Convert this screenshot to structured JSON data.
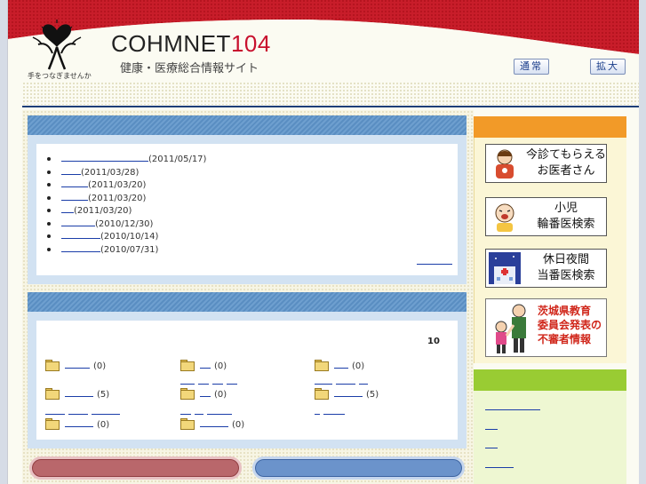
{
  "header": {
    "logo_caption": "手をつなぎませんか",
    "title_main": "COHMNET",
    "title_num": "104",
    "subtitle": "健康・医療総合情報サイト",
    "btn_normal": "通常",
    "btn_large": "拡大"
  },
  "news": {
    "items": [
      {
        "link_w": 98,
        "date": "(2011/05/17)"
      },
      {
        "link_w": 22,
        "date": "(2011/03/28)"
      },
      {
        "link_w": 30,
        "date": "(2011/03/20)"
      },
      {
        "link_w": 30,
        "date": "(2011/03/20)"
      },
      {
        "link_w": 14,
        "date": "(2011/03/20)"
      },
      {
        "link_w": 38,
        "date": "(2010/12/30)"
      },
      {
        "link_w": 44,
        "date": "(2010/10/14)"
      },
      {
        "link_w": 44,
        "date": "(2010/07/31)"
      }
    ]
  },
  "categories": {
    "count_label": "10",
    "items": [
      {
        "count": "(0)"
      },
      {
        "count": "(0)"
      },
      {
        "count": "(0)"
      },
      {
        "count": "(5)"
      },
      {
        "count": "(0)"
      },
      {
        "count": "(5)"
      },
      {
        "count": "(0)"
      },
      {
        "count": "(0)"
      }
    ]
  },
  "sidebar": {
    "banner1": "今診てもらえる\nお医者さん",
    "banner2": "小児\n輪番医検索",
    "banner3": "休日夜間\n当番医検索",
    "banner4": "茨城県教育\n委員会発表の\n不審者情報"
  },
  "colors": {
    "banner_red": "#c8102e",
    "panel_blue": "#5a8ec2",
    "side_orange": "#f29a28",
    "side_green": "#99cc33"
  }
}
